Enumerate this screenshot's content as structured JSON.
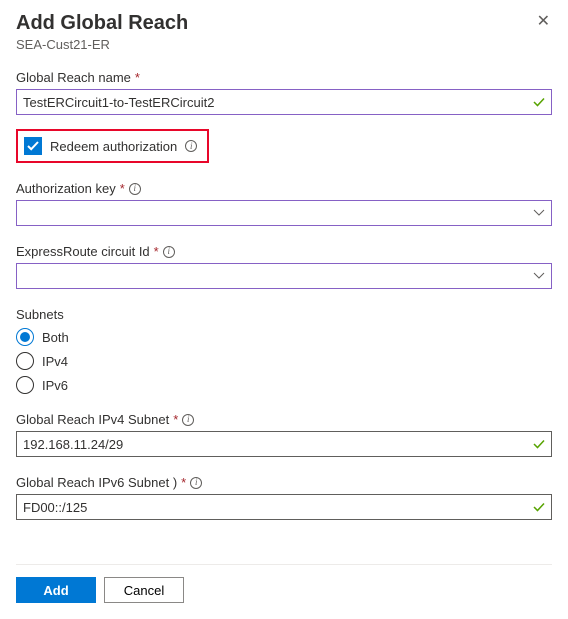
{
  "header": {
    "title": "Add Global Reach",
    "subtitle": "SEA-Cust21-ER"
  },
  "fields": {
    "global_reach_name": {
      "label": "Global Reach name",
      "value": "TestERCircuit1-to-TestERCircuit2"
    },
    "redeem_auth": {
      "label": "Redeem authorization"
    },
    "auth_key": {
      "label": "Authorization key",
      "value": ""
    },
    "circuit_id": {
      "label": "ExpressRoute circuit Id",
      "value": ""
    },
    "subnets": {
      "label": "Subnets",
      "options": [
        "Both",
        "IPv4",
        "IPv6"
      ],
      "selected": "Both"
    },
    "ipv4_subnet": {
      "label": "Global Reach IPv4 Subnet",
      "value": "192.168.11.24/29"
    },
    "ipv6_subnet": {
      "label": "Global Reach IPv6 Subnet )",
      "value": "FD00::/125"
    }
  },
  "footer": {
    "add": "Add",
    "cancel": "Cancel"
  }
}
